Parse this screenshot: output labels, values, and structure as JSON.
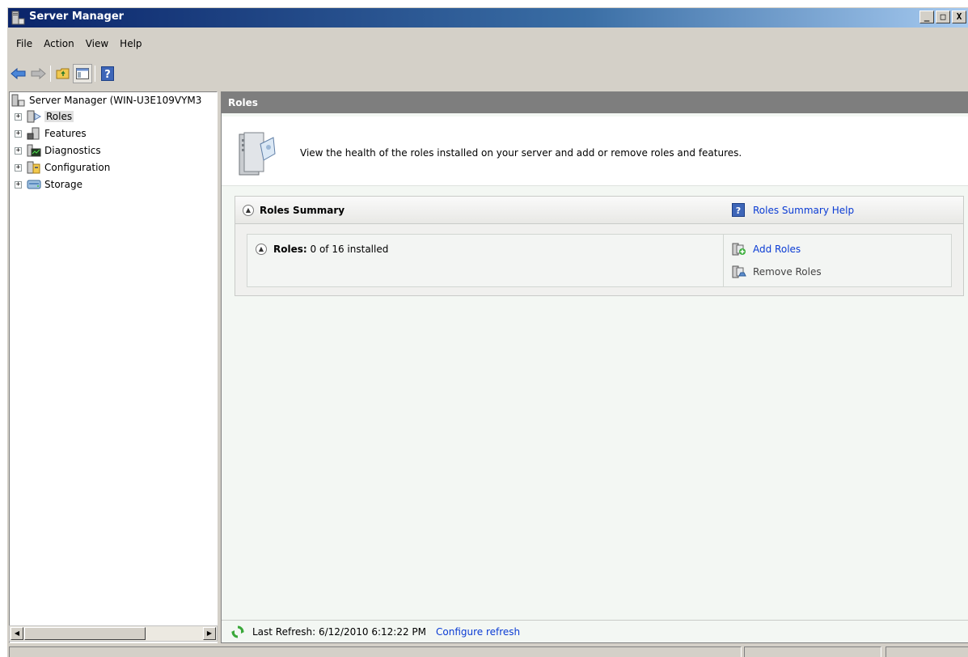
{
  "window": {
    "title": "Server Manager",
    "buttons": {
      "minimize": "_",
      "maximize": "□",
      "close": "X"
    }
  },
  "menu": {
    "items": [
      "File",
      "Action",
      "View",
      "Help"
    ]
  },
  "toolbar": {
    "buttons": [
      "back-icon",
      "forward-icon",
      "up-folder-icon",
      "show-hide-tree-icon",
      "help-icon"
    ]
  },
  "tree": {
    "root": "Server Manager (WIN-U3E109VYM3",
    "nodes": [
      {
        "label": "Roles",
        "icon": "roles-icon",
        "selected": true
      },
      {
        "label": "Features",
        "icon": "features-icon"
      },
      {
        "label": "Diagnostics",
        "icon": "diagnostics-icon"
      },
      {
        "label": "Configuration",
        "icon": "configuration-icon"
      },
      {
        "label": "Storage",
        "icon": "storage-icon"
      }
    ]
  },
  "main": {
    "header": "Roles",
    "intro": "View the health of the roles installed on your server and add or remove roles and features.",
    "summary": {
      "title": "Roles Summary",
      "help": "Roles Summary Help",
      "roles_label": "Roles:",
      "roles_value": "0 of 16 installed",
      "add": "Add Roles",
      "remove": "Remove Roles"
    },
    "footer": {
      "last_refresh": "Last Refresh: 6/12/2010 6:12:22 PM",
      "configure": "Configure refresh"
    }
  },
  "colors": {
    "link": "#0a3bd4",
    "header_bg": "#7e7e7e",
    "pane_bg": "#f3f7f3"
  }
}
